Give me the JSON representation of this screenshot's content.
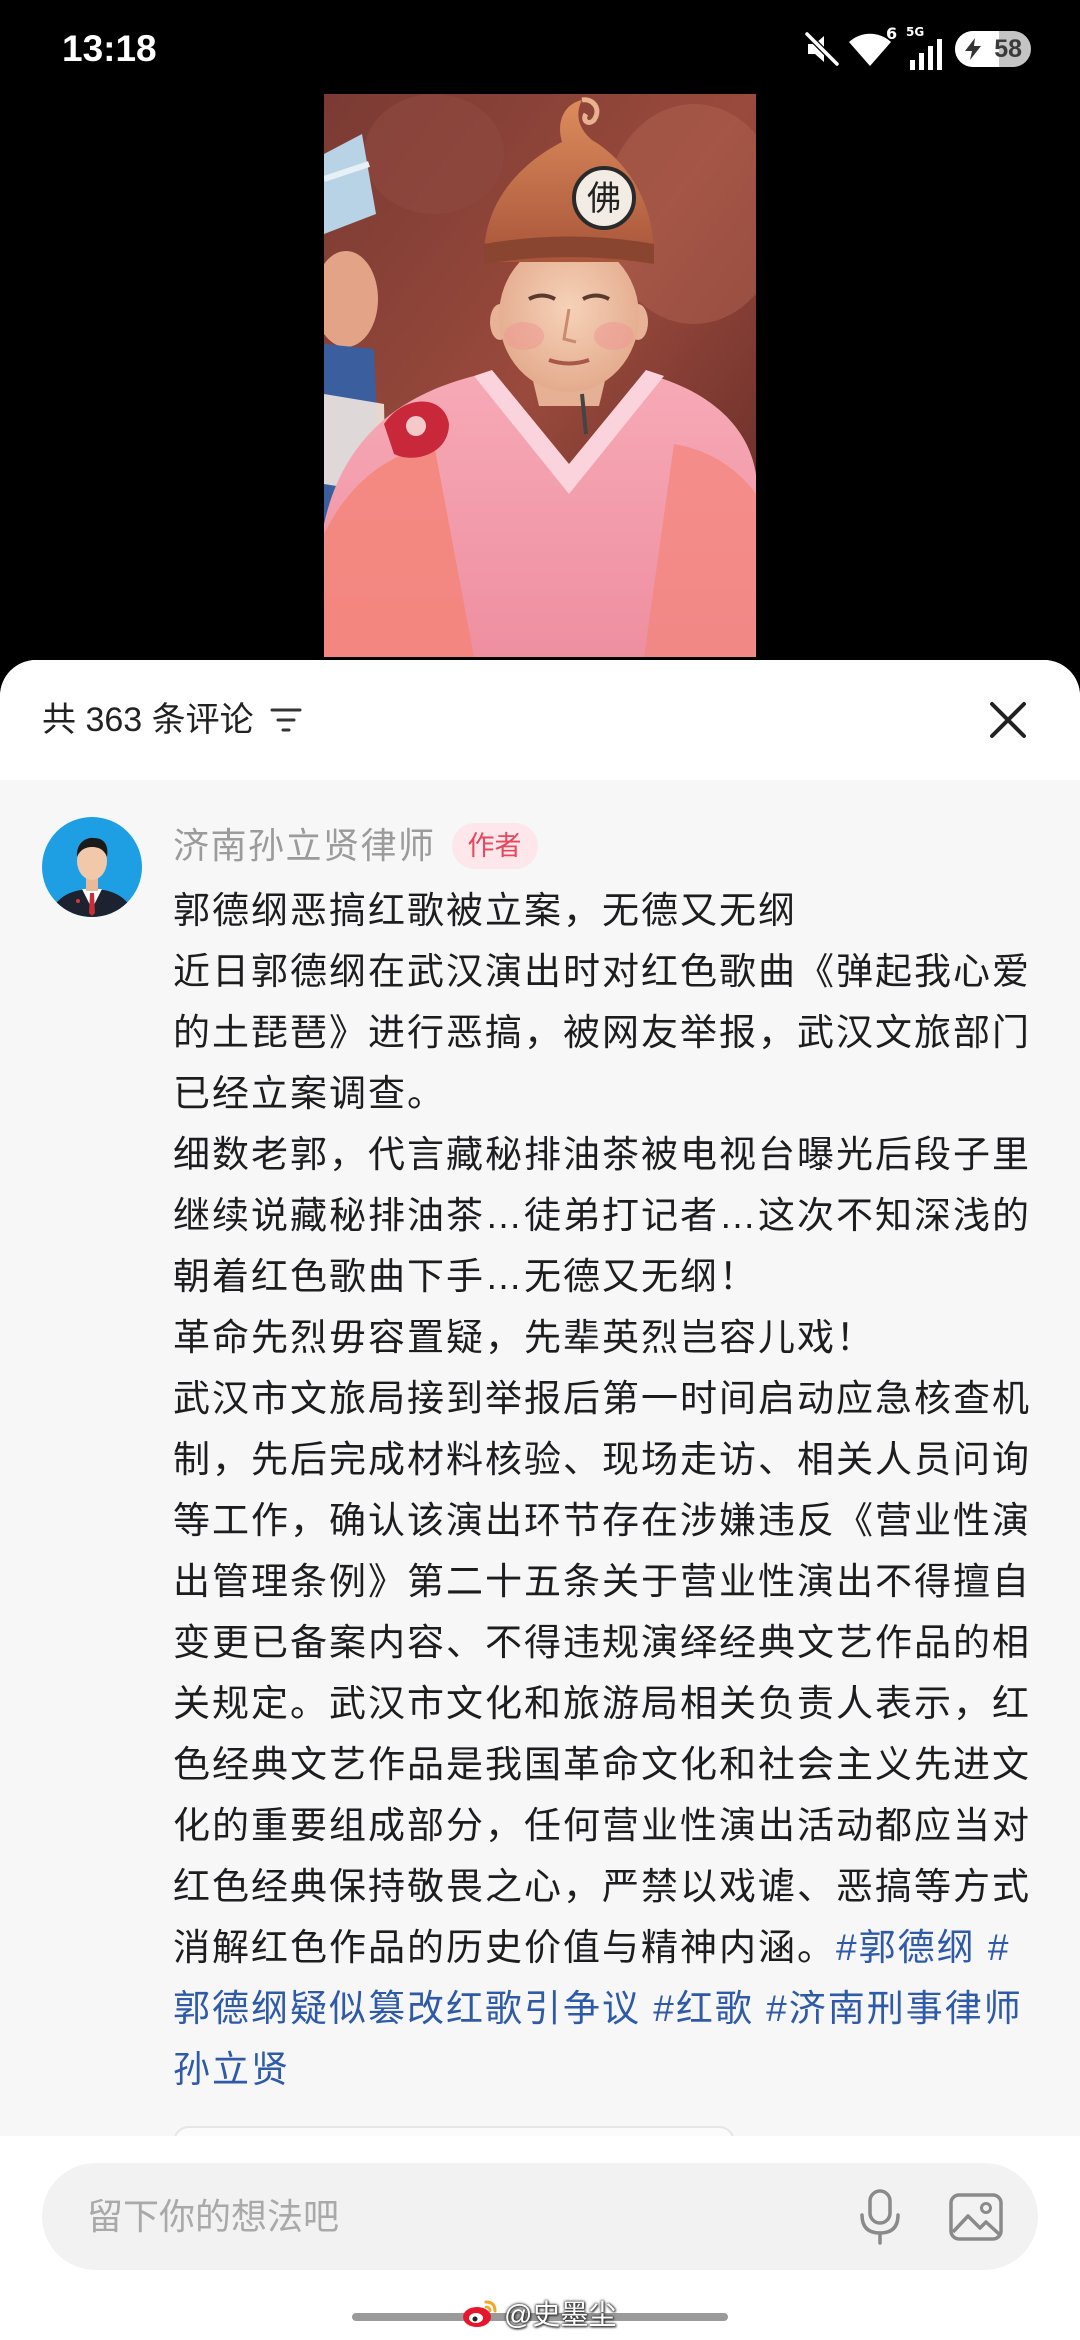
{
  "status_bar": {
    "time": "13:18",
    "wifi_badge": "6",
    "network_type": "5G",
    "battery_level": "58",
    "icons": [
      "mute-icon",
      "wifi-icon",
      "signal-icon",
      "battery-charging-icon"
    ]
  },
  "video": {
    "hat_badge_text": "佛"
  },
  "comments_sheet": {
    "count_label": "共 363 条评论",
    "filter_icon": "filter-icon",
    "close_icon": "close-icon"
  },
  "comment": {
    "author": "济南孙立贤律师",
    "author_badge": "作者",
    "paragraphs": [
      "郭德纲恶搞红歌被立案，无德又无纲",
      "近日郭德纲在武汉演出时对红色歌曲《弹起我心爱的土琵琶》进行恶搞，被网友举报，武汉文旅部门已经立案调查。",
      "细数老郭，代言藏秘排油茶被电视台曝光后段子里继续说藏秘排油茶…徒弟打记者…这次不知深浅的朝着红色歌曲下手…无德又无纲！",
      "革命先烈毋容置疑，先辈英烈岂容儿戏！",
      "武汉市文旅局接到举报后第一时间启动应急核查机制，先后完成材料核验、现场走访、相关人员问询等工作，确认该演出环节存在涉嫌违反《营业性演出管理条例》第二十五条关于营业性演出不得擅自变更已备案内容、不得违规演绎经典文艺作品的相关规定。武汉市文化和旅游局相关负责人表示，红色经典文艺作品是我国革命文化和社会主义先进文化的重要组成部分，任何营业性演出活动都应当对红色经典保持敬畏之心，严禁以戏谑、恶搞等方式消解红色作品的历史价值与精神内涵。"
    ],
    "hashtags": [
      "#郭德纲",
      "#郭德纲疑似篡改红歌引争议",
      "#红歌",
      "#济南刑事律师孙立贤"
    ]
  },
  "input_bar": {
    "placeholder": "留下你的想法吧",
    "mic_icon": "microphone-icon",
    "image_icon": "image-icon"
  },
  "watermark": {
    "text": "@史墨尘",
    "logo_icon": "weibo-logo-icon"
  },
  "colors": {
    "hashtag": "#2e5aa8",
    "author_name": "#9b9b9b",
    "badge_bg": "#fde7eb",
    "badge_text": "#e5475e",
    "sheet_bg": "#f7f7f8",
    "input_bg": "#f2f2f2"
  }
}
